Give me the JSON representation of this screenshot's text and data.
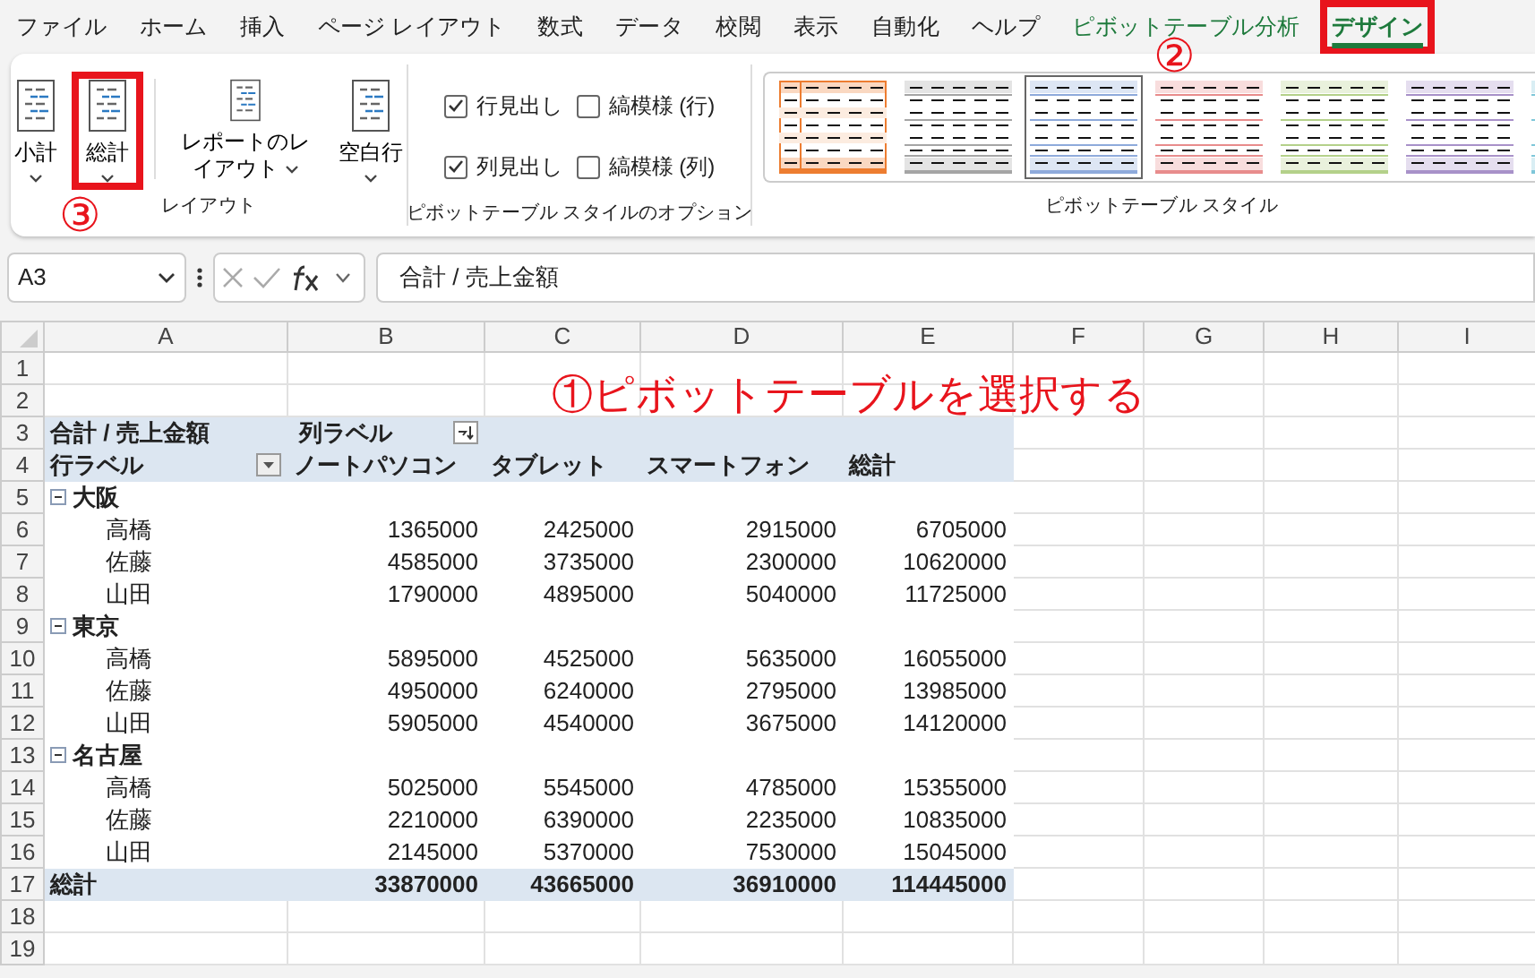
{
  "menu_tabs": [
    {
      "label": "ファイル",
      "kind": "normal",
      "selected": false,
      "highlighted": false
    },
    {
      "label": "ホーム",
      "kind": "normal",
      "selected": false,
      "highlighted": false
    },
    {
      "label": "挿入",
      "kind": "normal",
      "selected": false,
      "highlighted": false
    },
    {
      "label": "ページ レイアウト",
      "kind": "normal",
      "selected": false,
      "highlighted": false
    },
    {
      "label": "数式",
      "kind": "normal",
      "selected": false,
      "highlighted": false
    },
    {
      "label": "データ",
      "kind": "normal",
      "selected": false,
      "highlighted": false
    },
    {
      "label": "校閲",
      "kind": "normal",
      "selected": false,
      "highlighted": false
    },
    {
      "label": "表示",
      "kind": "normal",
      "selected": false,
      "highlighted": false
    },
    {
      "label": "自動化",
      "kind": "normal",
      "selected": false,
      "highlighted": false
    },
    {
      "label": "ヘルプ",
      "kind": "normal",
      "selected": false,
      "highlighted": false
    },
    {
      "label": "ピボットテーブル分析",
      "kind": "contextual",
      "selected": false,
      "highlighted": false
    },
    {
      "label": "デザイン",
      "kind": "contextual",
      "selected": true,
      "highlighted": true
    }
  ],
  "ribbon": {
    "layout_group": {
      "label": "レイアウト",
      "buttons": [
        {
          "label_lines": [
            "小計"
          ],
          "highlighted": false
        },
        {
          "label_lines": [
            "総計"
          ],
          "highlighted": true
        },
        {
          "label_lines": [
            "レポートのレ",
            "イアウト"
          ],
          "highlighted": false
        },
        {
          "label_lines": [
            "空白行"
          ],
          "highlighted": false
        }
      ]
    },
    "options_group": {
      "label": "ピボットテーブル スタイルのオプション",
      "checkboxes": [
        {
          "label": "行見出し",
          "checked": true
        },
        {
          "label": "縞模様 (行)",
          "checked": false
        },
        {
          "label": "列見出し",
          "checked": true
        },
        {
          "label": "縞模様 (列)",
          "checked": false
        }
      ]
    },
    "styles_group": {
      "label": "ピボットテーブル スタイル",
      "items": [
        {
          "kind": "grid",
          "color": "#ed7d31",
          "selected": false
        },
        {
          "kind": "banded",
          "color": "#a5a5a5",
          "selected": false
        },
        {
          "kind": "banded",
          "color": "#8eaadb",
          "selected": true
        },
        {
          "kind": "banded",
          "color": "#e88c8c",
          "selected": false
        },
        {
          "kind": "banded",
          "color": "#b4d18a",
          "selected": false
        },
        {
          "kind": "banded",
          "color": "#a891c9",
          "selected": false
        },
        {
          "kind": "banded",
          "color": "#7fc7d9",
          "selected": false
        }
      ]
    }
  },
  "formula_bar": {
    "name_box": "A3",
    "formula": "合計 / 売上金額"
  },
  "column_headers": [
    "A",
    "B",
    "C",
    "D",
    "E",
    "F",
    "G",
    "H",
    "I"
  ],
  "row_headers": [
    "1",
    "2",
    "3",
    "4",
    "5",
    "6",
    "7",
    "8",
    "9",
    "10",
    "11",
    "12",
    "13",
    "14",
    "15",
    "16",
    "17",
    "18",
    "19"
  ],
  "pivot": {
    "value_label": "合計 / 売上金額",
    "column_label": "列ラベル",
    "row_label": "行ラベル",
    "columns": [
      "ノートパソコン",
      "タブレット",
      "スマートフォン",
      "総計"
    ],
    "groups": [
      {
        "name": "大阪",
        "expanded": true,
        "rows": [
          {
            "name": "高橋",
            "values": [
              "1365000",
              "2425000",
              "2915000",
              "6705000"
            ]
          },
          {
            "name": "佐藤",
            "values": [
              "4585000",
              "3735000",
              "2300000",
              "10620000"
            ]
          },
          {
            "name": "山田",
            "values": [
              "1790000",
              "4895000",
              "5040000",
              "11725000"
            ]
          }
        ]
      },
      {
        "name": "東京",
        "expanded": true,
        "rows": [
          {
            "name": "高橋",
            "values": [
              "5895000",
              "4525000",
              "5635000",
              "16055000"
            ]
          },
          {
            "name": "佐藤",
            "values": [
              "4950000",
              "6240000",
              "2795000",
              "13985000"
            ]
          },
          {
            "name": "山田",
            "values": [
              "5905000",
              "4540000",
              "3675000",
              "14120000"
            ]
          }
        ]
      },
      {
        "name": "名古屋",
        "expanded": true,
        "rows": [
          {
            "name": "高橋",
            "values": [
              "5025000",
              "5545000",
              "4785000",
              "15355000"
            ]
          },
          {
            "name": "佐藤",
            "values": [
              "2210000",
              "6390000",
              "2235000",
              "10835000"
            ]
          },
          {
            "name": "山田",
            "values": [
              "2145000",
              "5370000",
              "7530000",
              "15045000"
            ]
          }
        ]
      }
    ],
    "grand_total": {
      "label": "総計",
      "values": [
        "33870000",
        "43665000",
        "36910000",
        "114445000"
      ]
    }
  },
  "annotations": {
    "callout": "①ピボットテーブルを選択する",
    "step_2": "②",
    "step_3": "③"
  }
}
